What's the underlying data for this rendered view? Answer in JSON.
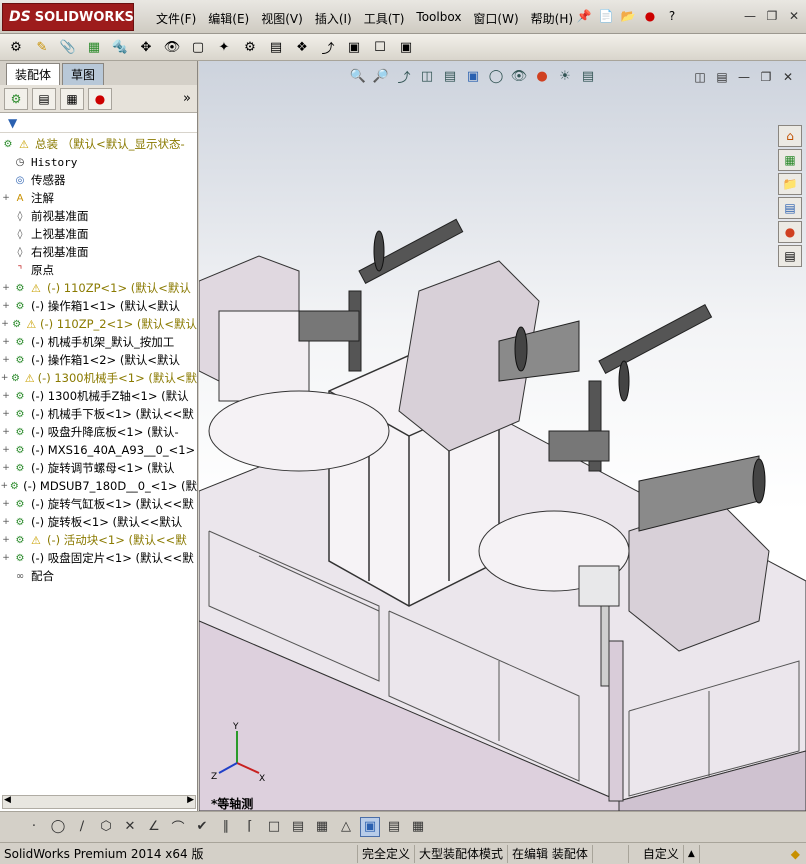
{
  "app": {
    "logo_text": "SOLIDWORKS",
    "logo_prefix": "DS"
  },
  "menu": [
    "文件(F)",
    "编辑(E)",
    "视图(V)",
    "插入(I)",
    "工具(T)",
    "Toolbox",
    "窗口(W)",
    "帮助(H)"
  ],
  "panel": {
    "tabs": [
      "装配体",
      "草图"
    ],
    "filter_icon": "filter-icon",
    "expand_symbol": "»"
  },
  "tree": {
    "root": "总装 （默认<默认_显示状态-",
    "items": [
      {
        "label": "History",
        "icon": "history-icon",
        "expander": "",
        "warn": false,
        "style": "mono"
      },
      {
        "label": "传感器",
        "icon": "sensor-icon",
        "expander": "",
        "warn": false,
        "style": "normal"
      },
      {
        "label": "注解",
        "icon": "annotation-icon",
        "expander": "+",
        "warn": false,
        "style": "normal"
      },
      {
        "label": "前视基准面",
        "icon": "plane-icon",
        "expander": "",
        "warn": false,
        "style": "normal"
      },
      {
        "label": "上视基准面",
        "icon": "plane-icon",
        "expander": "",
        "warn": false,
        "style": "normal"
      },
      {
        "label": "右视基准面",
        "icon": "plane-icon",
        "expander": "",
        "warn": false,
        "style": "normal"
      },
      {
        "label": "原点",
        "icon": "origin-icon",
        "expander": "",
        "warn": false,
        "style": "normal"
      },
      {
        "label": "(-) 110ZP<1> (默认<默认",
        "icon": "assembly-icon",
        "expander": "+",
        "warn": true,
        "style": "yellow"
      },
      {
        "label": "(-) 操作箱1<1> (默认<默认",
        "icon": "assembly-icon",
        "expander": "+",
        "warn": false,
        "style": "normal"
      },
      {
        "label": "(-) 110ZP_2<1> (默认<默认",
        "icon": "assembly-icon",
        "expander": "+",
        "warn": true,
        "style": "yellow"
      },
      {
        "label": "(-) 机械手机架_默认_按加工",
        "icon": "assembly-icon",
        "expander": "+",
        "warn": false,
        "style": "normal"
      },
      {
        "label": "(-) 操作箱1<2> (默认<默认",
        "icon": "assembly-icon",
        "expander": "+",
        "warn": false,
        "style": "normal"
      },
      {
        "label": "(-) 1300机械手<1> (默认<默",
        "icon": "assembly-icon",
        "expander": "+",
        "warn": true,
        "style": "yellow"
      },
      {
        "label": "(-) 1300机械手Z轴<1> (默认",
        "icon": "assembly-icon",
        "expander": "+",
        "warn": false,
        "style": "normal"
      },
      {
        "label": "(-) 机械手下板<1> (默认<<默",
        "icon": "assembly-icon",
        "expander": "+",
        "warn": false,
        "style": "normal"
      },
      {
        "label": "(-) 吸盘升降底板<1> (默认-",
        "icon": "assembly-icon",
        "expander": "+",
        "warn": false,
        "style": "normal"
      },
      {
        "label": "(-) MXS16_40A_A93__0_<1>",
        "icon": "assembly-icon",
        "expander": "+",
        "warn": false,
        "style": "normal"
      },
      {
        "label": "(-) 旋转调节螺母<1> (默认",
        "icon": "assembly-icon",
        "expander": "+",
        "warn": false,
        "style": "normal"
      },
      {
        "label": "(-) MDSUB7_180D__0_<1> (默",
        "icon": "assembly-icon",
        "expander": "+",
        "warn": false,
        "style": "normal"
      },
      {
        "label": "(-) 旋转气缸板<1> (默认<<默",
        "icon": "assembly-icon",
        "expander": "+",
        "warn": false,
        "style": "normal"
      },
      {
        "label": "(-) 旋转板<1> (默认<<默认",
        "icon": "assembly-icon",
        "expander": "+",
        "warn": false,
        "style": "normal"
      },
      {
        "label": "(-) 活动块<1> (默认<<默",
        "icon": "assembly-icon",
        "expander": "+",
        "warn": true,
        "style": "yellow"
      },
      {
        "label": "(-) 吸盘固定片<1> (默认<<默",
        "icon": "assembly-icon",
        "expander": "+",
        "warn": false,
        "style": "normal"
      },
      {
        "label": "配合",
        "icon": "mates-icon",
        "expander": "",
        "warn": false,
        "style": "normal"
      }
    ]
  },
  "viewport": {
    "view_label": "*等轴测",
    "triad": {
      "x": "X",
      "y": "Y",
      "z": "Z"
    }
  },
  "status": {
    "product": "SolidWorks Premium 2014 x64 版",
    "definition": "完全定义",
    "mode": "大型装配体模式",
    "editing": "在编辑 装配体",
    "units": "自定义",
    "arrow": "▲"
  },
  "colors": {
    "logo_bg": "#9d1c1c",
    "warning": "#c8a000",
    "machine_body": "#e8e0e8",
    "viewport_top": "#cdd3dd"
  }
}
